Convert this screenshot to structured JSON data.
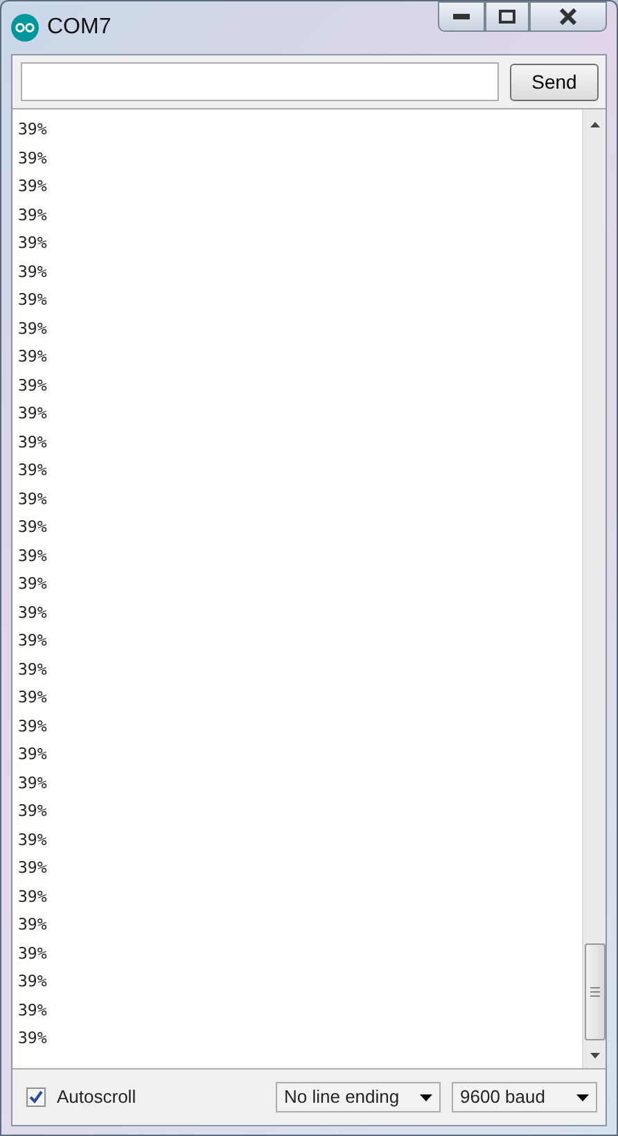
{
  "window": {
    "title": "COM7"
  },
  "send_button": "Send",
  "output_lines": [
    "39%",
    "39%",
    "39%",
    "39%",
    "39%",
    "39%",
    "39%",
    "39%",
    "39%",
    "39%",
    "39%",
    "39%",
    "39%",
    "39%",
    "39%",
    "39%",
    "39%",
    "39%",
    "39%",
    "39%",
    "39%",
    "39%",
    "39%",
    "39%",
    "39%",
    "39%",
    "39%",
    "39%",
    "39%",
    "39%",
    "39%",
    "39%",
    "39%"
  ],
  "autoscroll": {
    "label": "Autoscroll",
    "checked": true
  },
  "line_ending": "No line ending",
  "baud_rate": "9600 baud"
}
